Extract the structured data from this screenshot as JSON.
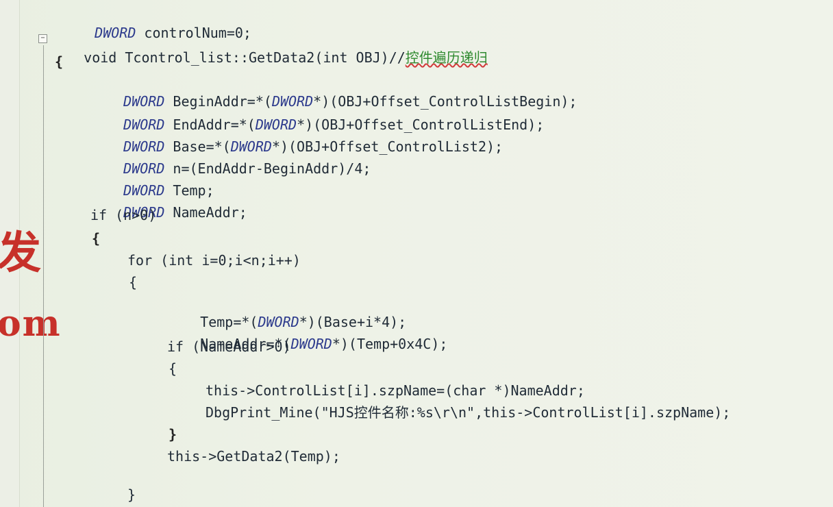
{
  "watermark": {
    "line1": "发",
    "line2": "om"
  },
  "gutter": {
    "fold_symbol": "−"
  },
  "code": {
    "l0": {
      "type": "DWORD",
      "rest": " controlNum=0;"
    },
    "l1": {
      "text": "void Tcontrol_list::GetData2(int OBJ)//",
      "comment": "控件遍历递归"
    },
    "l2": "{",
    "l3": {
      "type": "DWORD",
      "rest": " BeginAddr=*(",
      "type2": "DWORD",
      "rest2": "*)(OBJ+Offset_ControlListBegin);"
    },
    "l4": {
      "type": "DWORD",
      "rest": " EndAddr=*(",
      "type2": "DWORD",
      "rest2": "*)(OBJ+Offset_ControlListEnd);"
    },
    "l5": {
      "type": "DWORD",
      "rest": " Base=*(",
      "type2": "DWORD",
      "rest2": "*)(OBJ+Offset_ControlList2);"
    },
    "l6": {
      "type": "DWORD",
      "rest": " n=(EndAddr-BeginAddr)/4;"
    },
    "l7": {
      "type": "DWORD",
      "rest": " Temp;"
    },
    "l8": {
      "type": "DWORD",
      "rest": " NameAddr;"
    },
    "l9": "if (n>0)",
    "l10": "{",
    "l11": "for (int i=0;i<n;i++)",
    "l12": "{",
    "l13": {
      "pre": "Temp=*(",
      "type": "DWORD",
      "post": "*)(Base+i*4);"
    },
    "l14": {
      "pre": "NameAddr=*(",
      "type": "DWORD",
      "post": "*)(Temp+0x4C);"
    },
    "l15": "if (NameAddr>0)",
    "l16": "{",
    "l17": "this->ControlList[i].szpName=(char *)NameAddr;",
    "l18": "DbgPrint_Mine(\"HJS控件名称:%s\\r\\n\",this->ControlList[i].szpName);",
    "l19": "}",
    "l20": "this->GetData2(Temp);",
    "l21": "}"
  }
}
